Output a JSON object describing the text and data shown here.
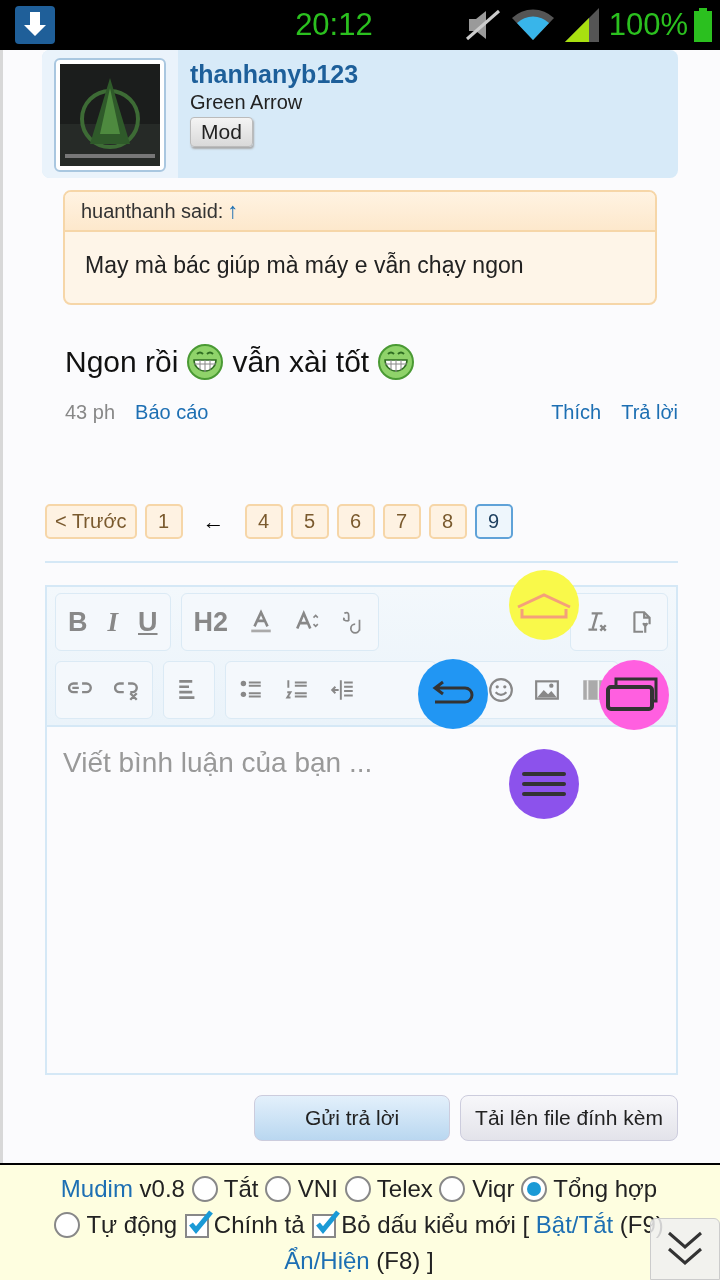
{
  "status_bar": {
    "time": "20:12",
    "battery": "100%"
  },
  "post": {
    "username": "thanhanyb123",
    "user_title": "Green Arrow",
    "badge": "Mod",
    "quote": {
      "author": "huanthanh said:",
      "jump": "↑",
      "text": "May mà bác giúp mà máy e vẫn chạy ngon"
    },
    "message": [
      {
        "kind": "text",
        "text": "Ngon rồi"
      },
      {
        "kind": "smiley"
      },
      {
        "kind": "text",
        "text": "vẫn xài tốt"
      },
      {
        "kind": "smiley"
      }
    ],
    "time": "43 ph",
    "actions": [
      {
        "label": "Báo cáo"
      },
      {
        "label": "Thích"
      },
      {
        "label": "Trả lời"
      }
    ]
  },
  "pagination": [
    {
      "kind": "link",
      "label": "< Trước",
      "selected": false
    },
    {
      "kind": "link",
      "label": "1",
      "selected": false
    },
    {
      "kind": "gap",
      "label": "←"
    },
    {
      "kind": "link",
      "label": "4",
      "selected": false
    },
    {
      "kind": "link",
      "label": "5",
      "selected": false
    },
    {
      "kind": "link",
      "label": "6",
      "selected": false
    },
    {
      "kind": "link",
      "label": "7",
      "selected": false
    },
    {
      "kind": "link",
      "label": "8",
      "selected": false
    },
    {
      "kind": "link",
      "label": "9",
      "selected": true
    }
  ],
  "editor": {
    "format_buttons": [
      "B",
      "I",
      "U",
      "H2"
    ],
    "placeholder": "Viết bình luận của bạn ..."
  },
  "buttons": [
    {
      "label": "Gửi trả lời",
      "primary": true
    },
    {
      "label": "Tải lên file đính kèm",
      "primary": false
    }
  ],
  "mudim": {
    "name": "Mudim",
    "version": "v0.8",
    "options": [
      {
        "kind": "radio",
        "label": "Tắt",
        "selected": false
      },
      {
        "kind": "radio",
        "label": "VNI",
        "selected": false
      },
      {
        "kind": "radio",
        "label": "Telex",
        "selected": false
      },
      {
        "kind": "radio",
        "label": "Viqr",
        "selected": false
      },
      {
        "kind": "radio",
        "label": "Tổng hợp",
        "selected": true
      },
      {
        "kind": "radio",
        "label": "Tự động",
        "selected": false
      },
      {
        "kind": "checkbox",
        "label": "Chính tả",
        "checked": true
      },
      {
        "kind": "checkbox",
        "label": "Bỏ dấu kiểu mới",
        "checked": true
      }
    ],
    "hotkeys": [
      {
        "kind": "text",
        "text": "["
      },
      {
        "kind": "link",
        "text": "Bật/Tắt"
      },
      {
        "kind": "text",
        "text": "(F9)"
      },
      {
        "kind": "link",
        "text": "Ẩn/Hiện"
      },
      {
        "kind": "text",
        "text": "(F8) ]"
      }
    ]
  }
}
